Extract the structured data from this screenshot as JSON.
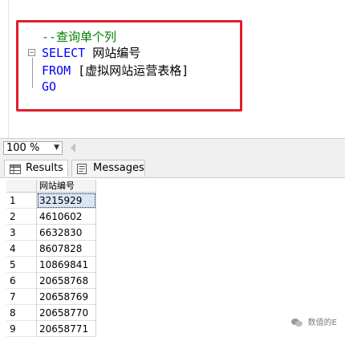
{
  "editor": {
    "comment": "--查询单个列",
    "select_kw": "SELECT",
    "select_col": "网站编号",
    "from_kw": "FROM",
    "from_table": "[虚拟网站运营表格]",
    "go_kw": "GO"
  },
  "toolbar": {
    "zoom_value": "100 %",
    "zoom_arrow_icon": "dropdown-arrow-icon"
  },
  "tabs": {
    "results_label": "Results",
    "messages_label": "Messages"
  },
  "grid": {
    "column_header": "网站编号",
    "rows": [
      {
        "num": "1",
        "value": "3215929"
      },
      {
        "num": "2",
        "value": "4610602"
      },
      {
        "num": "3",
        "value": "6632830"
      },
      {
        "num": "4",
        "value": "8607828"
      },
      {
        "num": "5",
        "value": "10869841"
      },
      {
        "num": "6",
        "value": "20658768"
      },
      {
        "num": "7",
        "value": "20658769"
      },
      {
        "num": "8",
        "value": "20658770"
      },
      {
        "num": "9",
        "value": "20658771"
      }
    ]
  },
  "watermark": {
    "text": "数值的E"
  },
  "colors": {
    "keyword": "#0000ff",
    "comment": "#008000",
    "highlight_border": "#e01e2b"
  }
}
